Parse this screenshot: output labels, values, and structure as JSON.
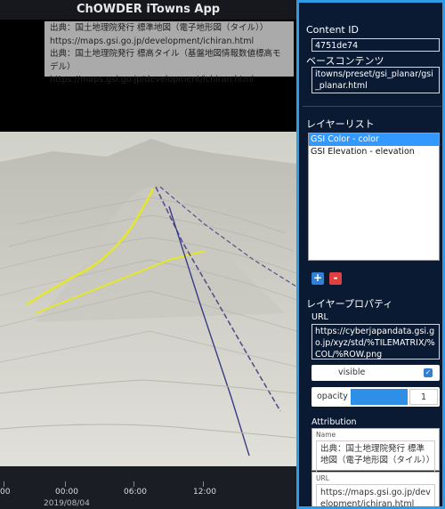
{
  "app": {
    "title": "ChOWDER iTowns App"
  },
  "attribution_overlay": {
    "lines": [
      "出典：国土地理院発行 標準地図（電子地形図（タイル））",
      "https://maps.gsi.go.jp/development/ichiran.html",
      "出典：国土地理院発行 標高タイル（基盤地図情報数値標高モデル）",
      "https://maps.gsi.go.jp/development/ichiran.html"
    ]
  },
  "timeline": {
    "ticks": [
      "00",
      "00:00",
      "06:00",
      "12:00"
    ],
    "date": "2019/08/04"
  },
  "panel": {
    "content_id_label": "Content ID",
    "content_id_value": "4751de74",
    "base_content_label": "ベースコンテンツ",
    "base_content_value": "itowns/preset/gsi_planar/gsi_planar.html",
    "layer_list_label": "レイヤーリスト",
    "layers": [
      {
        "label": "GSI Color - color",
        "selected": true
      },
      {
        "label": "GSI Elevation - elevation",
        "selected": false
      }
    ],
    "add_label": "+",
    "remove_label": "-",
    "layer_props_label": "レイヤープロパティ",
    "url_label": "URL",
    "url_value": "https://cyberjapandata.gsi.go.jp/xyz/std/%TILEMATRIX/%COL/%ROW.png",
    "visible_label": "visible",
    "visible_checked": true,
    "opacity_label": "opacity",
    "opacity_value": "1",
    "opacity_fraction": 1,
    "attribution_label": "Attribution",
    "name_label": "Name",
    "name_value": "出典：国土地理院発行 標準地図（電子地形図（タイル））",
    "attr_url_label": "URL",
    "attr_url_value": "https://maps.gsi.go.jp/development/ichiran.html"
  },
  "colors": {
    "panel_bg": "#0a1a33",
    "panel_border": "#2e9ce6",
    "selected": "#3399ff",
    "opacity_fill": "#2e8fe6"
  }
}
